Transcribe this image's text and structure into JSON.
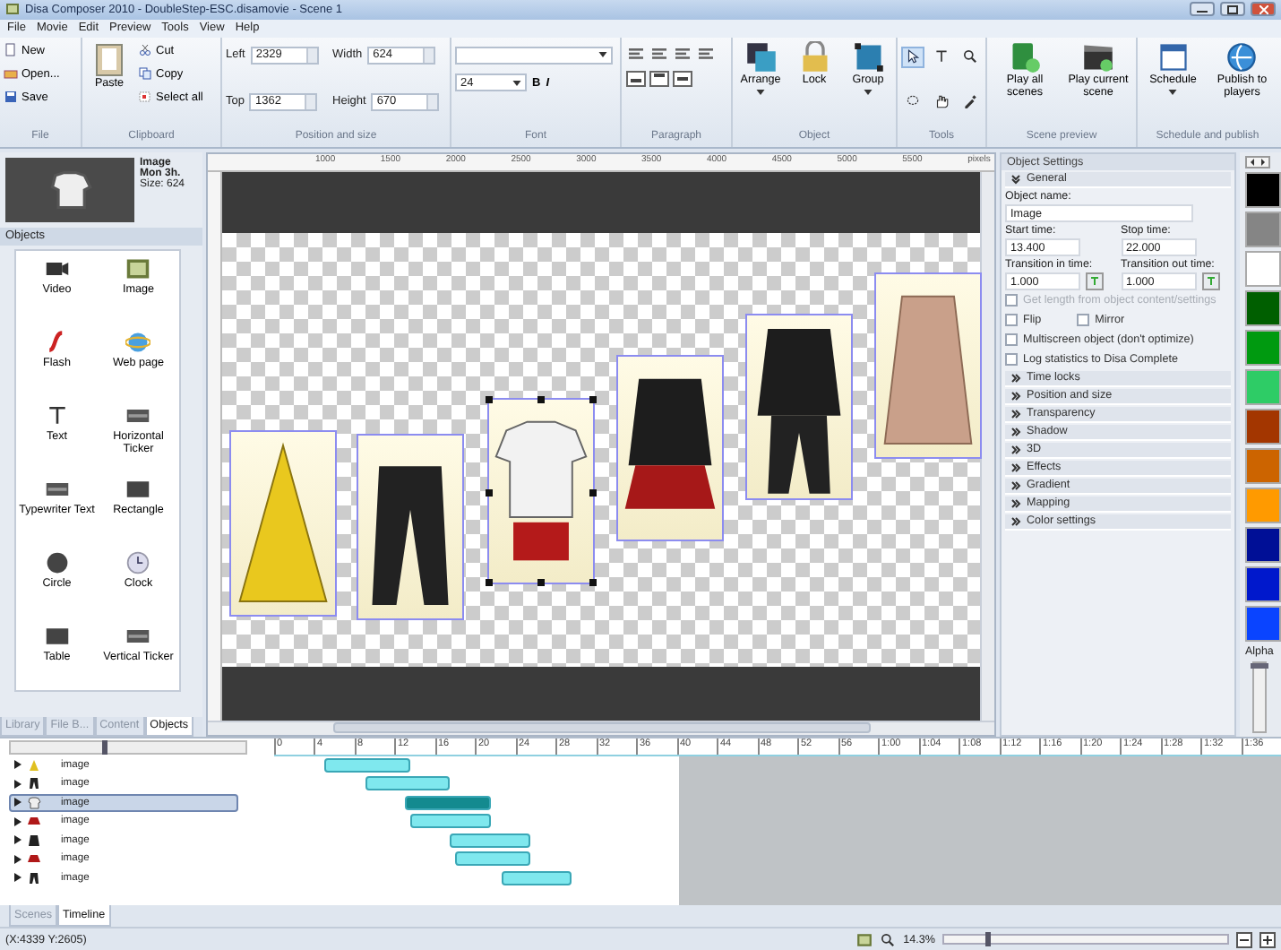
{
  "window": {
    "title": "Disa Composer 2010 - DoubleStep-ESC.disamovie - Scene 1"
  },
  "menu": [
    "File",
    "Movie",
    "Edit",
    "Preview",
    "Tools",
    "View",
    "Help"
  ],
  "ribbon": {
    "file": {
      "label": "File",
      "buttons": [
        {
          "label": "New",
          "kind": "new"
        },
        {
          "label": "Open...",
          "kind": "open"
        },
        {
          "label": "Save",
          "kind": "save"
        }
      ]
    },
    "clipboard": {
      "label": "Clipboard",
      "paste": "Paste",
      "buttons": [
        {
          "label": "Cut",
          "kind": "cut"
        },
        {
          "label": "Copy",
          "kind": "copy"
        },
        {
          "label": "Select all",
          "kind": "selectall"
        }
      ]
    },
    "position": {
      "label": "Position and size",
      "fields": [
        {
          "label": "Left",
          "value": "2329"
        },
        {
          "label": "Width",
          "value": "624"
        },
        {
          "label": "Top",
          "value": "1362"
        },
        {
          "label": "Height",
          "value": "670"
        }
      ]
    },
    "font": {
      "label": "Font",
      "size": "24",
      "bold": "B",
      "italic": "I"
    },
    "paragraph": {
      "label": "Paragraph"
    },
    "object": {
      "label": "Object",
      "buttons": [
        {
          "label": "Arrange",
          "kind": "arrange",
          "dropdown": true
        },
        {
          "label": "Lock",
          "kind": "lock",
          "dropdown": false
        },
        {
          "label": "Group",
          "kind": "group",
          "dropdown": true
        }
      ]
    },
    "tools": {
      "label": "Tools",
      "items": [
        {
          "kind": "pointer",
          "selected": true
        },
        {
          "kind": "text",
          "selected": false
        },
        {
          "kind": "zoom",
          "selected": false
        },
        {
          "kind": "lasso",
          "selected": false
        },
        {
          "kind": "hand",
          "selected": false
        },
        {
          "kind": "eyedropper",
          "selected": false
        }
      ]
    },
    "scene_preview": {
      "label": "Scene preview",
      "buttons": [
        {
          "label": "Play all scenes",
          "kind": "playall",
          "dropdown": false
        },
        {
          "label": "Play current scene",
          "kind": "clapper",
          "dropdown": false
        }
      ]
    },
    "schedule": {
      "label": "Schedule and publish",
      "buttons": [
        {
          "label": "Schedule",
          "kind": "calendar",
          "dropdown": true
        },
        {
          "label": "Publish to players",
          "kind": "globe",
          "dropdown": false
        }
      ]
    }
  },
  "preview": {
    "lines": [
      "Image",
      "Mon 3h.",
      "Size: 624"
    ]
  },
  "objects": {
    "title": "Objects",
    "items": [
      {
        "label": "Video",
        "kind": "video"
      },
      {
        "label": "Image",
        "kind": "image"
      },
      {
        "label": "Flash",
        "kind": "flash"
      },
      {
        "label": "Web page",
        "kind": "web"
      },
      {
        "label": "Text",
        "kind": "text"
      },
      {
        "label": "Horizontal Ticker",
        "kind": "ticker"
      },
      {
        "label": "Typewriter Text",
        "kind": "ticker"
      },
      {
        "label": "Rectangle",
        "kind": "rect"
      },
      {
        "label": "Circle",
        "kind": "circle"
      },
      {
        "label": "Clock",
        "kind": "clock"
      },
      {
        "label": "Table",
        "kind": "rect"
      },
      {
        "label": "Vertical Ticker",
        "kind": "ticker"
      }
    ],
    "tabs": [
      {
        "label": "Library",
        "selected": false
      },
      {
        "label": "File B...",
        "selected": false
      },
      {
        "label": "Content",
        "selected": false
      },
      {
        "label": "Objects",
        "selected": true
      }
    ]
  },
  "canvas": {
    "ruler": [
      "1000",
      "1500",
      "2000",
      "2500",
      "3000",
      "3500",
      "4000",
      "4500",
      "5000",
      "5500",
      "pixels"
    ],
    "items": [
      {
        "kind": "dress",
        "selected": false
      },
      {
        "kind": "pants",
        "selected": false
      },
      {
        "kind": "shirt",
        "selected": true
      },
      {
        "kind": "jacket",
        "selected": false
      },
      {
        "kind": "suit",
        "selected": false
      },
      {
        "kind": "coat",
        "selected": false
      }
    ]
  },
  "settings": {
    "title": "Object Settings",
    "general": {
      "title": "General",
      "expanded": true
    },
    "name": {
      "label": "Object name:",
      "value": "Image"
    },
    "start": {
      "label": "Start time:",
      "value": "13.400"
    },
    "stop": {
      "label": "Stop time:",
      "value": "22.000"
    },
    "tin": {
      "label": "Transition in time:",
      "value": "1.000"
    },
    "tout": {
      "label": "Transition out time:",
      "value": "1.000"
    },
    "checks": [
      {
        "label": "Get length from object content/settings",
        "checked": false,
        "disabled": true
      },
      {
        "label": "Flip",
        "checked": false,
        "disabled": false
      },
      {
        "label": "Mirror",
        "checked": false,
        "disabled": false
      },
      {
        "label": "Multiscreen object (don't optimize)",
        "checked": false,
        "disabled": false
      },
      {
        "label": "Log statistics to Disa Complete",
        "checked": false,
        "disabled": false
      }
    ],
    "sections": [
      "Time locks",
      "Position and size",
      "Transparency",
      "Shadow",
      "3D",
      "Effects",
      "Gradient",
      "Mapping",
      "Color settings"
    ]
  },
  "palette": {
    "swatches": [
      {
        "color": "#000000"
      },
      {
        "color": "#858585"
      },
      {
        "color": "#ffffff"
      },
      {
        "color": "#005f00"
      },
      {
        "color": "#009a10"
      },
      {
        "color": "#2ecc66"
      },
      {
        "color": "#a33600"
      },
      {
        "color": "#cc6400"
      },
      {
        "color": "#ff9a00"
      },
      {
        "color": "#000f96"
      },
      {
        "color": "#0018cc"
      },
      {
        "color": "#0a44ff"
      }
    ],
    "alpha": {
      "label": "Alpha",
      "level": 1
    }
  },
  "timeline": {
    "ticks": [
      "0",
      "4",
      "8",
      "12",
      "16",
      "20",
      "24",
      "28",
      "32",
      "36",
      "40",
      "44",
      "48",
      "52",
      "56",
      "1:00",
      "1:04",
      "1:08",
      "1:12",
      "1:16",
      "1:20",
      "1:24",
      "1:28",
      "1:32",
      "1:36"
    ],
    "zoom": {
      "level": 0.4
    },
    "tracks": [
      {
        "name": "image",
        "kind": "dress",
        "selected": false
      },
      {
        "name": "image",
        "kind": "pants",
        "selected": false
      },
      {
        "name": "image",
        "kind": "shirt",
        "selected": true
      },
      {
        "name": "image",
        "kind": "skirt",
        "selected": false
      },
      {
        "name": "image",
        "kind": "jacket",
        "selected": false
      },
      {
        "name": "image",
        "kind": "skirt",
        "selected": false
      },
      {
        "name": "image",
        "kind": "pants",
        "selected": false
      }
    ]
  },
  "bottom_tabs": [
    {
      "label": "Scenes",
      "selected": false
    },
    {
      "label": "Timeline",
      "selected": true
    }
  ],
  "status": {
    "coords": "(X:4339 Y:2605)",
    "zoom": "14.3%",
    "zoom_level": {
      "level": 0.15
    }
  }
}
